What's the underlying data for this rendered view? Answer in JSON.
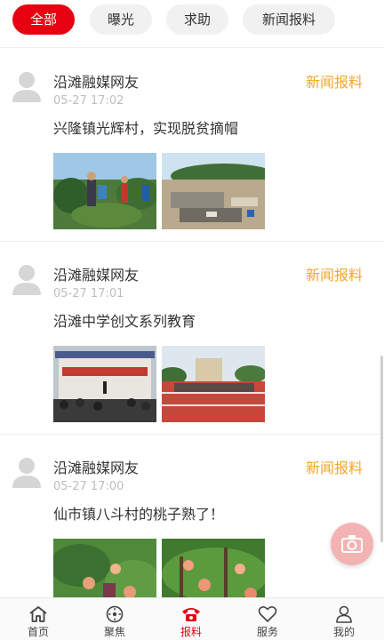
{
  "filters": [
    "全部",
    "曝光",
    "求助",
    "新闻报料"
  ],
  "active_filter": "全部",
  "posts": [
    {
      "author": "沿滩融媒网友",
      "time": "05-27 17:02",
      "tag": "新闻报料",
      "title": "兴隆镇光辉村，实现脱贫摘帽"
    },
    {
      "author": "沿滩融媒网友",
      "time": "05-27 17:01",
      "tag": "新闻报料",
      "title": "沿滩中学创文系列教育"
    },
    {
      "author": "沿滩融媒网友",
      "time": "05-27 17:00",
      "tag": "新闻报料",
      "title": "仙市镇八斗村的桃子熟了！"
    }
  ],
  "tabs": [
    {
      "label": "首页",
      "icon": "home-icon"
    },
    {
      "label": "聚焦",
      "icon": "focus-icon"
    },
    {
      "label": "报料",
      "icon": "phone-icon"
    },
    {
      "label": "服务",
      "icon": "heart-icon"
    },
    {
      "label": "我的",
      "icon": "user-icon"
    }
  ],
  "active_tab": "报料",
  "colors": {
    "accent": "#e60012",
    "tag": "#f5a623",
    "muted": "#bdbdbd",
    "fab": "#f4b3b3"
  }
}
